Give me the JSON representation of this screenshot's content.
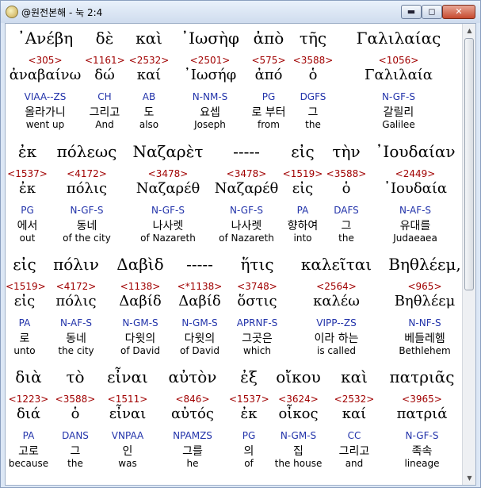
{
  "window": {
    "title": "@원전본해 - 눅 2:4",
    "buttons": {
      "minimize": "▬",
      "maximize": "◻",
      "close": "✕"
    }
  },
  "rows": [
    {
      "words": [
        {
          "greek": "᾽Ανέβη",
          "strong": "<305>",
          "lexeme": "ἀναβαίνω",
          "parse": "VIAA--ZS",
          "korean": "올라가니",
          "english": "went up"
        },
        {
          "greek": "δὲ",
          "strong": "<1161>",
          "lexeme": "δώ",
          "parse": "CH",
          "korean": "그리고",
          "english": "And"
        },
        {
          "greek": "καὶ",
          "strong": "<2532>",
          "lexeme": "καί",
          "parse": "AB",
          "korean": "도",
          "english": "also"
        },
        {
          "greek": "᾽Ιωσὴφ",
          "strong": "<2501>",
          "lexeme": "᾽Ιωσήφ",
          "parse": "N-NM-S",
          "korean": "요셉",
          "english": "Joseph"
        },
        {
          "greek": "ἀπὸ",
          "strong": "<575>",
          "lexeme": "ἀπό",
          "parse": "PG",
          "korean": "로 부터",
          "english": "from"
        },
        {
          "greek": "τῆς",
          "strong": "<3588>",
          "lexeme": "ὁ",
          "parse": "DGFS",
          "korean": "그",
          "english": "the"
        },
        {
          "greek": "Γαλιλαίας",
          "strong": "<1056>",
          "lexeme": "Γαλιλαία",
          "parse": "N-GF-S",
          "korean": "갈릴리",
          "english": "Galilee"
        }
      ]
    },
    {
      "words": [
        {
          "greek": "ἐκ",
          "strong": "<1537>",
          "lexeme": "ἐκ",
          "parse": "PG",
          "korean": "에서",
          "english": "out"
        },
        {
          "greek": "πόλεως",
          "strong": "<4172>",
          "lexeme": "πόλις",
          "parse": "N-GF-S",
          "korean": "동네",
          "english": "of the city"
        },
        {
          "greek": "Ναζαρὲτ",
          "strong": "<3478>",
          "lexeme": "Ναζαρέθ",
          "parse": "N-GF-S",
          "korean": "나사렛",
          "english": "of Nazareth"
        },
        {
          "greek": "-----",
          "strong": "<3478>",
          "lexeme": "Ναζαρέθ",
          "parse": "N-GF-S",
          "korean": "나사렛",
          "english": "of Nazareth"
        },
        {
          "greek": "εἰς",
          "strong": "<1519>",
          "lexeme": "εἰς",
          "parse": "PA",
          "korean": "향하여",
          "english": "into"
        },
        {
          "greek": "τὴν",
          "strong": "<3588>",
          "lexeme": "ὁ",
          "parse": "DAFS",
          "korean": "그",
          "english": "the"
        },
        {
          "greek": "᾽Ιουδαίαν",
          "strong": "<2449>",
          "lexeme": "᾽Ιουδαία",
          "parse": "N-AF-S",
          "korean": "유대를",
          "english": "Judaeaea"
        }
      ]
    },
    {
      "words": [
        {
          "greek": "εἰς",
          "strong": "<1519>",
          "lexeme": "εἰς",
          "parse": "PA",
          "korean": "로",
          "english": "unto"
        },
        {
          "greek": "πόλιν",
          "strong": "<4172>",
          "lexeme": "πόλις",
          "parse": "N-AF-S",
          "korean": "동네",
          "english": "the city"
        },
        {
          "greek": "Δαβὶδ",
          "strong": "<1138>",
          "lexeme": "Δαβίδ",
          "parse": "N-GM-S",
          "korean": "다윗의",
          "english": "of David"
        },
        {
          "greek": "-----",
          "strong": "<*1138>",
          "lexeme": "Δαβίδ",
          "parse": "N-GM-S",
          "korean": "다윗의",
          "english": "of David"
        },
        {
          "greek": "ἥτις",
          "strong": "<3748>",
          "lexeme": "ὅστις",
          "parse": "APRNF-S",
          "korean": "그곳은",
          "english": "which"
        },
        {
          "greek": "καλεῖται",
          "strong": "<2564>",
          "lexeme": "καλέω",
          "parse": "VIPP--ZS",
          "korean": "이라 하는",
          "english": "is called"
        },
        {
          "greek": "Βηθλέεμ,",
          "strong": "<965>",
          "lexeme": "Βηθλέεμ",
          "parse": "N-NF-S",
          "korean": "베들레헴",
          "english": "Bethlehem"
        }
      ]
    },
    {
      "words": [
        {
          "greek": "διὰ",
          "strong": "<1223>",
          "lexeme": "διά",
          "parse": "PA",
          "korean": "고로",
          "english": "because"
        },
        {
          "greek": "τὸ",
          "strong": "<3588>",
          "lexeme": "ὁ",
          "parse": "DANS",
          "korean": "그",
          "english": "the"
        },
        {
          "greek": "εἶναι",
          "strong": "<1511>",
          "lexeme": "εἶναι",
          "parse": "VNPAA",
          "korean": "인",
          "english": "was"
        },
        {
          "greek": "αὐτὸν",
          "strong": "<846>",
          "lexeme": "αὐτός",
          "parse": "NPAMZS",
          "korean": "그를",
          "english": "he"
        },
        {
          "greek": "ἐξ",
          "strong": "<1537>",
          "lexeme": "ἐκ",
          "parse": "PG",
          "korean": "의",
          "english": "of"
        },
        {
          "greek": "οἴκου",
          "strong": "<3624>",
          "lexeme": "οἶκος",
          "parse": "N-GM-S",
          "korean": "집",
          "english": "the house"
        },
        {
          "greek": "καὶ",
          "strong": "<2532>",
          "lexeme": "καί",
          "parse": "CC",
          "korean": "그리고",
          "english": "and"
        },
        {
          "greek": "πατριᾶς",
          "strong": "<3965>",
          "lexeme": "πατριά",
          "parse": "N-GF-S",
          "korean": "족속",
          "english": "lineage"
        }
      ]
    }
  ]
}
